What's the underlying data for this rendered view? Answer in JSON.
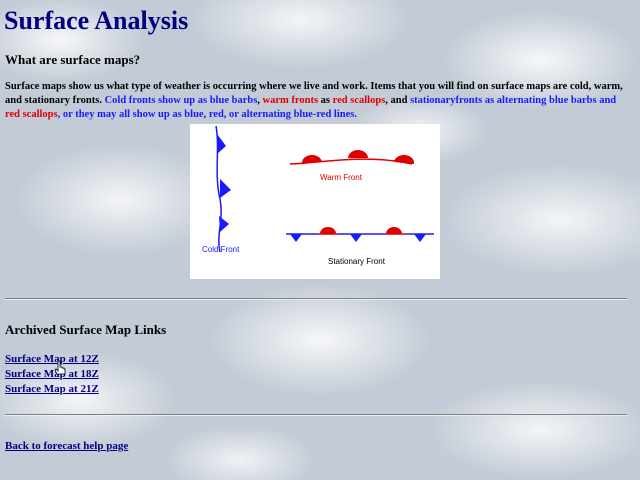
{
  "page": {
    "title": "Surface Analysis",
    "subheading": "What are surface maps?",
    "paragraph": {
      "p1": "Surface maps show us what type of weather is occurring where we live and work.  Items that you will find on surface maps are cold, warm, and stationary fronts.  ",
      "p2": "Cold fronts",
      "p3": " show up as ",
      "p4": "blue barbs",
      "p5": ", ",
      "p6": "warm fronts",
      "p7": " as ",
      "p8": "red scallops",
      "p9": ", and ",
      "p10": "stationaryfronts",
      "p11": " as alternating ",
      "p12": "blue barbs",
      "p13": " and ",
      "p14": "red scallops",
      "p15": ", or they may all show up as blue, red, or alternating blue-red lines."
    },
    "diagram": {
      "warm_front": "Warm Front",
      "cold_front": "Cold Front",
      "stationary_front": "Stationary Front",
      "colors": {
        "cold": "#1a1aff",
        "warm": "#e00000"
      }
    },
    "archive_heading": "Archived Surface Map Links",
    "archive_links": [
      "Surface Map at 12Z",
      "Surface Map at 18Z",
      "Surface Map at 21Z"
    ],
    "back_link": "Back to forecast help page"
  }
}
